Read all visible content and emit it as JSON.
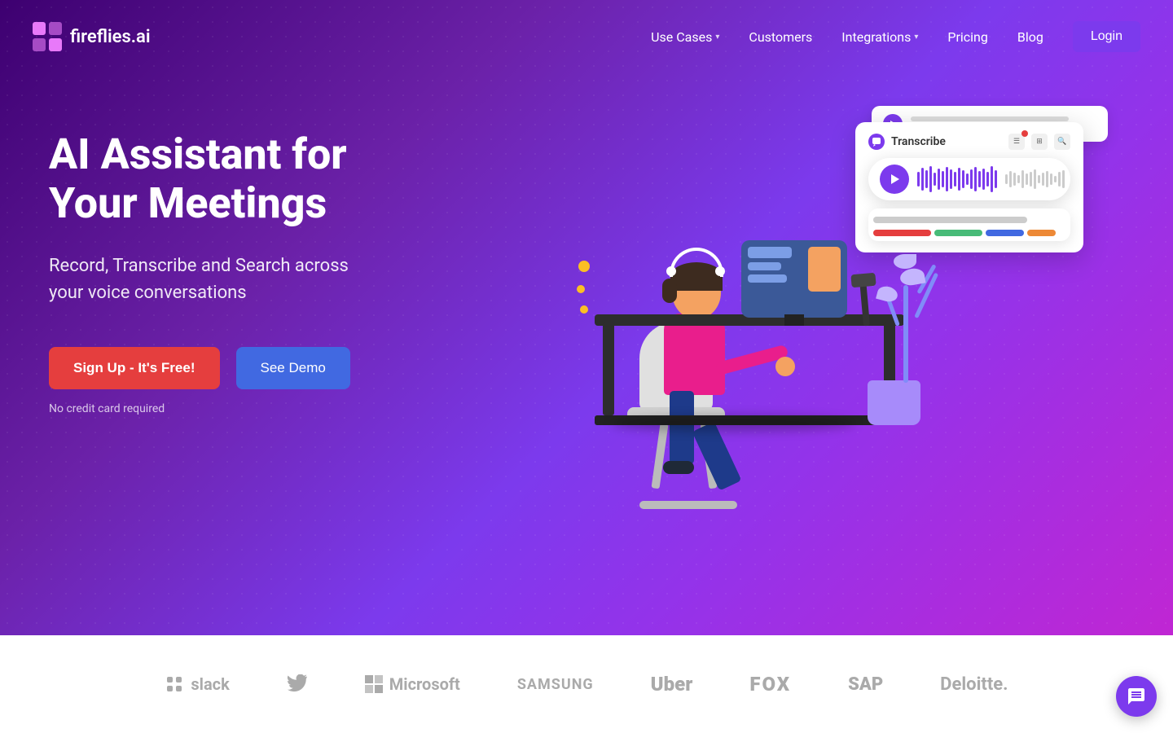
{
  "logo": {
    "text": "fireflies.ai"
  },
  "nav": {
    "use_cases": "Use Cases",
    "customers": "Customers",
    "integrations": "Integrations",
    "pricing": "Pricing",
    "blog": "Blog",
    "login": "Login"
  },
  "hero": {
    "title_line1": "AI Assistant for",
    "title_line2": "Your Meetings",
    "subtitle": "Record, Transcribe and Search across\nyour voice conversations",
    "btn_signup": "Sign Up - It's Free!",
    "btn_demo": "See Demo",
    "no_credit": "No credit card required"
  },
  "transcribe_card": {
    "label": "Transcribe"
  },
  "logos": {
    "brands": [
      "slack",
      "twitter",
      "Microsoft",
      "SAMSUNG",
      "Uber",
      "FOX",
      "SAP",
      "Deloitte."
    ]
  },
  "chat_support": {
    "icon": "💬"
  }
}
